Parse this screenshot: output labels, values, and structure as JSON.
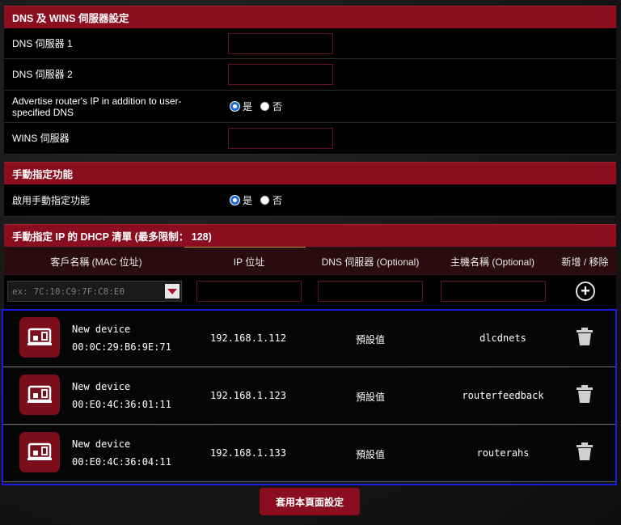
{
  "dns_section": {
    "title": "DNS 及 WINS 伺服器設定",
    "dns1_label": "DNS 伺服器 1",
    "dns1_value": "",
    "dns2_label": "DNS 伺服器 2",
    "dns2_value": "",
    "advertise_label": "Advertise router's IP in addition to user-specified DNS",
    "advertise_yes": "是",
    "advertise_no": "否",
    "advertise_selected": "yes",
    "wins_label": "WINS 伺服器",
    "wins_value": ""
  },
  "manual_section": {
    "title": "手動指定功能",
    "enable_label": "啟用手動指定功能",
    "enable_yes": "是",
    "enable_no": "否",
    "enable_selected": "yes"
  },
  "dhcp_list": {
    "title": "手動指定 IP 的 DHCP 清單 (最多限制： 128)",
    "columns": [
      "客戶名稱 (MAC 位址)",
      "IP 位址",
      "DNS 伺服器 (Optional)",
      "主機名稱 (Optional)",
      "新增 / 移除"
    ],
    "mac_placeholder": "ex: 7C:10:C9:7F:C8:E0",
    "devices": [
      {
        "name": "New device",
        "mac": "00:0C:29:B6:9E:71",
        "ip": "192.168.1.112",
        "dns": "預設值",
        "hostname": "dlcdnets"
      },
      {
        "name": "New device",
        "mac": "00:E0:4C:36:01:11",
        "ip": "192.168.1.123",
        "dns": "預設值",
        "hostname": "routerfeedback"
      },
      {
        "name": "New device",
        "mac": "00:E0:4C:36:04:11",
        "ip": "192.168.1.133",
        "dns": "預設值",
        "hostname": "routerahs"
      }
    ]
  },
  "apply_label": "套用本頁面設定",
  "colors": {
    "accent": "#8a0e1f",
    "selection_border": "#1a1ae8",
    "radio_on": "#1d6ed6"
  }
}
